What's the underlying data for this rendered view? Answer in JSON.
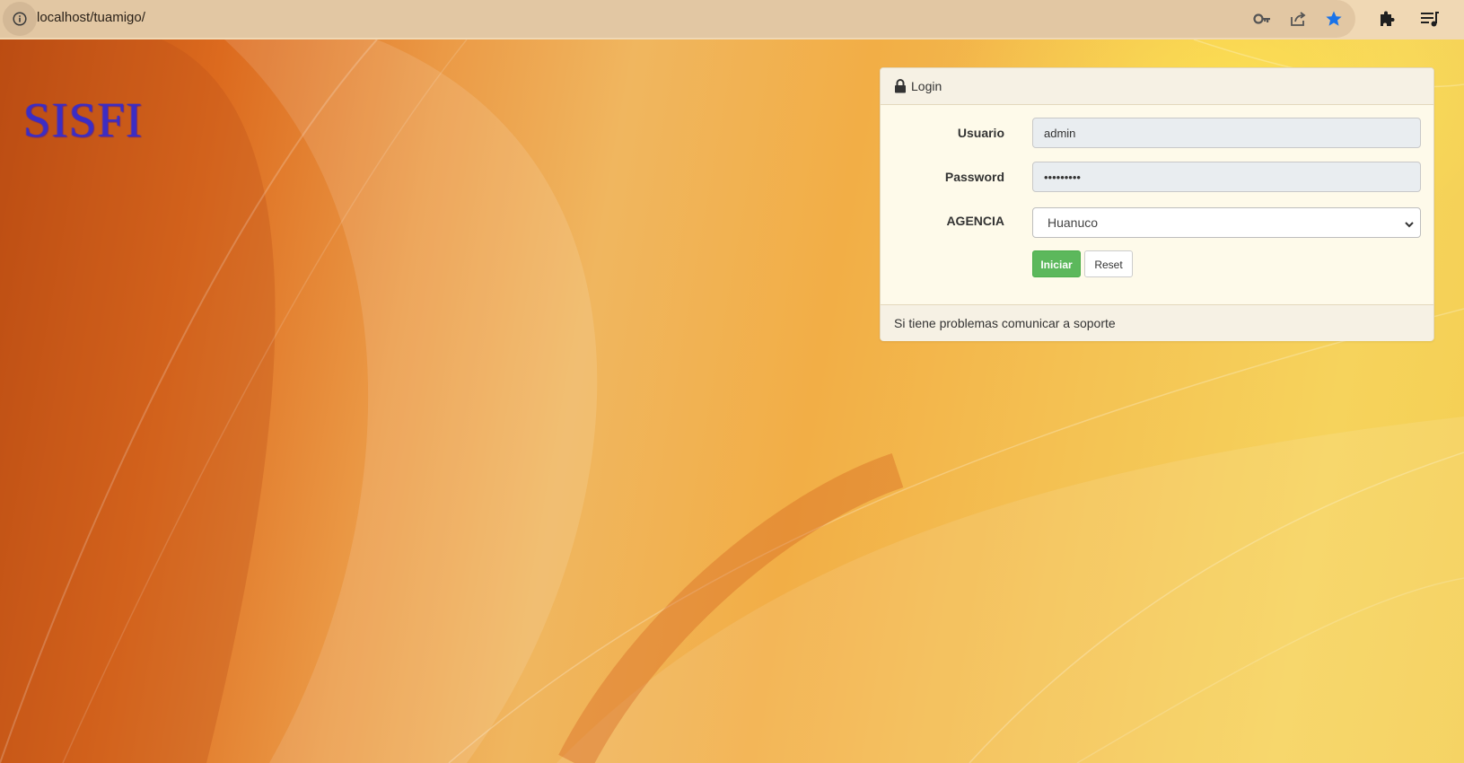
{
  "browser": {
    "url": "localhost/tuamigo/",
    "icons": [
      "info-icon",
      "key-icon",
      "share-icon",
      "star-icon",
      "extensions-icon",
      "reading-list-icon"
    ]
  },
  "page": {
    "logo": "SISFI"
  },
  "login": {
    "title": "Login",
    "title_icon": "lock-icon",
    "usuario_label": "Usuario",
    "usuario_value": "admin",
    "password_label": "Password",
    "password_value": "•••••••••",
    "agencia_label": "AGENCIA",
    "agencia_selected": "Huanuco",
    "iniciar_label": "Iniciar",
    "reset_label": "Reset",
    "footer": "Si tiene problemas comunicar a soporte"
  },
  "colors": {
    "logo": "#3c2dc4",
    "primary_button": "#5cb85c",
    "star_accent": "#1a73e8",
    "toolbar": "#f0d8b4"
  }
}
